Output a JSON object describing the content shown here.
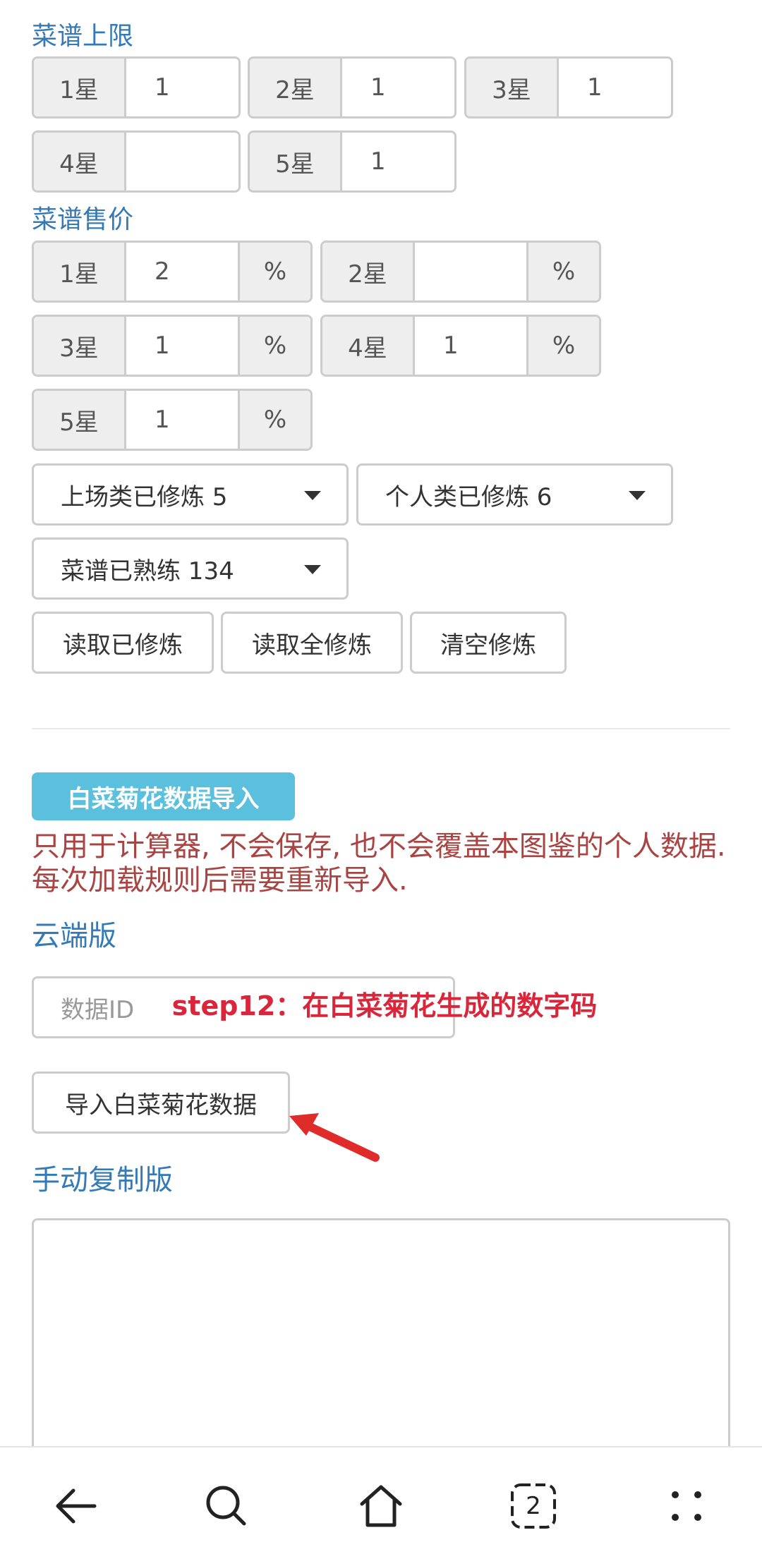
{
  "recipe_limit": {
    "label": "菜谱上限",
    "rows": [
      {
        "star": "1星",
        "value": "1"
      },
      {
        "star": "2星",
        "value": "1"
      },
      {
        "star": "3星",
        "value": "1"
      },
      {
        "star": "4星",
        "value": ""
      },
      {
        "star": "5星",
        "value": "1"
      }
    ]
  },
  "recipe_price": {
    "label": "菜谱售价",
    "unit": "%",
    "rows": [
      {
        "star": "1星",
        "value": "2"
      },
      {
        "star": "2星",
        "value": ""
      },
      {
        "star": "3星",
        "value": "1"
      },
      {
        "star": "4星",
        "value": "1"
      },
      {
        "star": "5星",
        "value": "1"
      }
    ]
  },
  "selects": {
    "onstage": "上场类已修炼 5",
    "personal": "个人类已修炼 6",
    "recipes": "菜谱已熟练 134"
  },
  "buttons": {
    "read_trained": "读取已修炼",
    "read_all": "读取全修炼",
    "clear": "清空修炼"
  },
  "import": {
    "badge": "白菜菊花数据导入",
    "warning": "只用于计算器, 不会保存, 也不会覆盖本图鉴的个人数据. 每次加载规则后需要重新导入.",
    "cloud_label": "云端版",
    "id_placeholder": "数据ID",
    "import_button": "导入白菜菊花数据",
    "manual_label": "手动复制版"
  },
  "annotation": {
    "text": "step12：在白菜菊花生成的数字码",
    "color": "#d9263a"
  },
  "navbar": {
    "icons": [
      "back-icon",
      "search-icon",
      "home-icon",
      "tabs-icon",
      "menu-icon"
    ],
    "tab_count": "2"
  },
  "colors": {
    "label_blue": "#337ab7",
    "badge_bg": "#5bc0de",
    "warning_red": "#a94442"
  }
}
